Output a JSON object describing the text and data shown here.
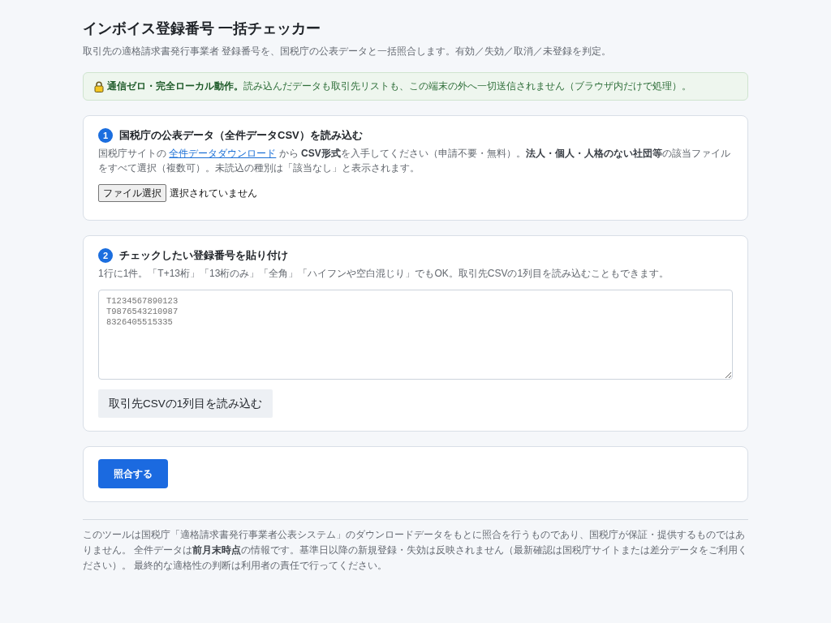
{
  "header": {
    "title": "インボイス登録番号 一括チェッカー",
    "subtitle": "取引先の適格請求書発行事業者 登録番号を、国税庁の公表データと一括照合します。有効／失効／取消／未登録を判定。"
  },
  "notice": {
    "text": "**通信ゼロ・完全ローカル動作。**読み込んだデータも取引先リストも、この端末の外へ一切送信されません（ブラウザ内だけで処理）。"
  },
  "steps": [
    {
      "kind": "file",
      "number": "1",
      "title": "国税庁の公表データ（全件データCSV）を読み込む",
      "description": {
        "before": "国税庁サイトの ",
        "link": "全件データダウンロード",
        "after": " から **CSV形式**を入手してください（申請不要・無料）。**法人・個人・人格のない社団等**の該当ファイルをすべて選択（複数可）。未読込の種別は「該当なし」と表示されます。"
      },
      "file_button": "ファイル選択",
      "file_status": "選択されていません"
    },
    {
      "kind": "paste",
      "number": "2",
      "title": "チェックしたい登録番号を貼り付け",
      "description": "1行に1件。「T+13桁」「13桁のみ」「全角」「ハイフンや空白混じり」でもOK。取引先CSVの1列目を読み込むこともできます。",
      "input": {
        "placeholder": "T1234567890123\nT9876543210987\n8326405515335"
      },
      "button": "取引先CSVの1列目を読み込む"
    }
  ],
  "submit_button": "照合する",
  "footer": {
    "text": "このツールは国税庁「適格請求書発行事業者公表システム」のダウンロードデータをもとに照合を行うものであり、国税庁が保証・提供するものではありません。 全件データは**前月末時点**の情報です。基準日以降の新規登録・失効は反映されません（最新確認は国税庁サイトまたは差分データをご利用ください）。 最終的な適格性の判断は利用者の責任で行ってください。"
  }
}
